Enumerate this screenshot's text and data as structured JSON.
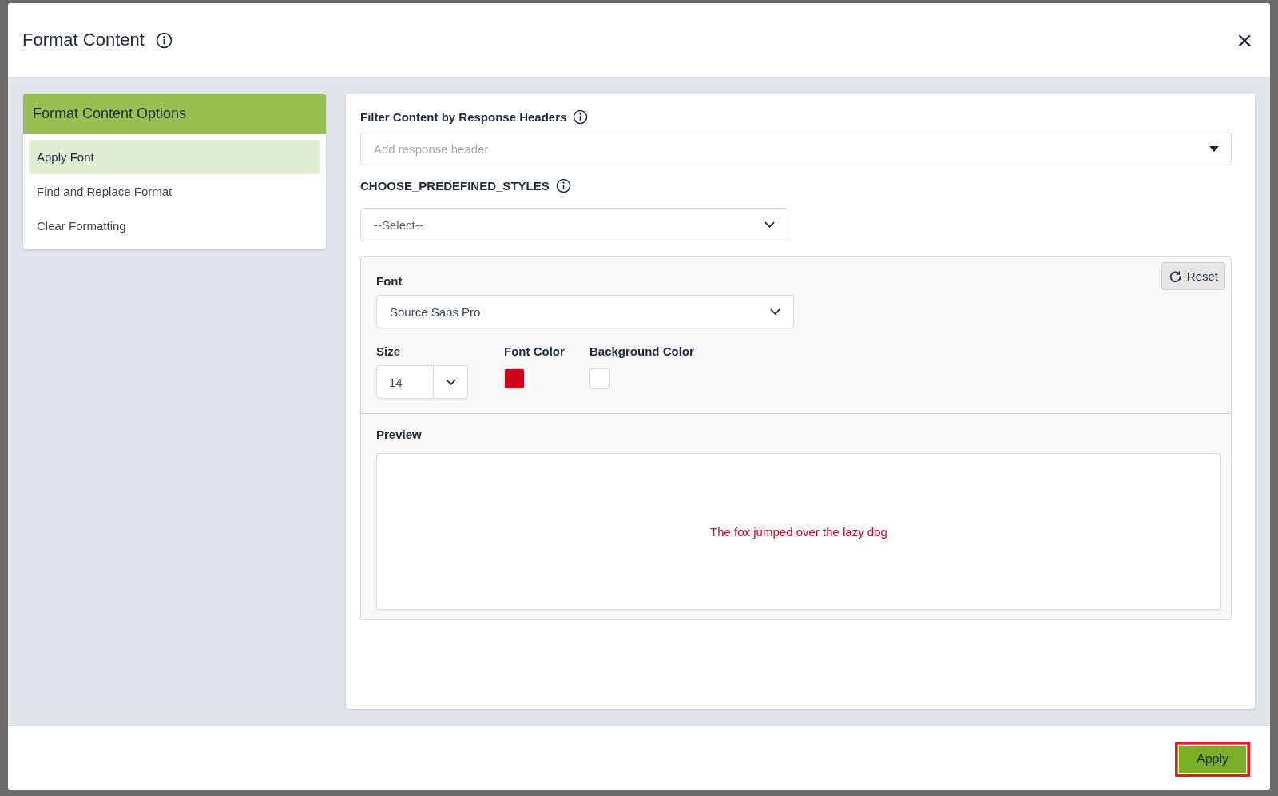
{
  "dialog": {
    "title": "Format Content",
    "close_icon": "×"
  },
  "options_panel": {
    "title": "Format Content Options",
    "items": [
      {
        "label": "Apply Font",
        "selected": true
      },
      {
        "label": "Find and Replace Format",
        "selected": false
      },
      {
        "label": "Clear Formatting",
        "selected": false
      }
    ]
  },
  "filter": {
    "label": "Filter Content by Response Headers",
    "placeholder": "Add response header"
  },
  "predefined_styles": {
    "label": "CHOOSE_PREDEFINED_STYLES",
    "value": "--Select--"
  },
  "font_settings": {
    "reset": "Reset",
    "font_label": "Font",
    "font_value": "Source Sans Pro",
    "size_label": "Size",
    "size_value": "14",
    "swatches": [
      {
        "label": "Font Color",
        "color": "#d0021b"
      },
      {
        "label": "Background Color",
        "color": "#ffffff"
      }
    ]
  },
  "preview": {
    "label": "Preview",
    "text": "The fox jumped over the lazy dog"
  },
  "footer": {
    "apply": "Apply"
  }
}
